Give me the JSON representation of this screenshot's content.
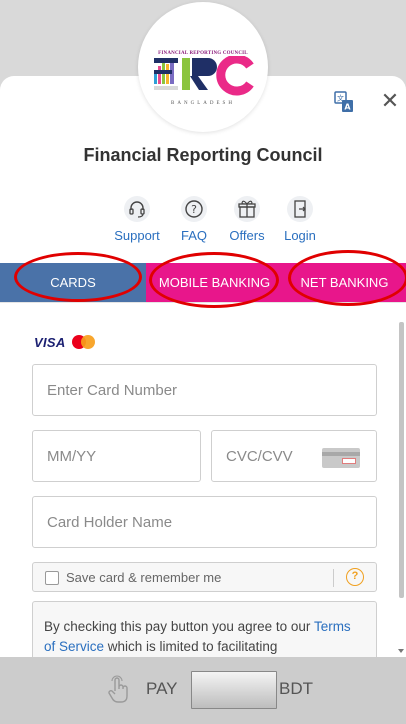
{
  "merchant": {
    "logo_text_top": "FINANCIAL REPORTING COUNCIL",
    "logo_text_main": "FRC",
    "logo_text_bottom": "BANGLADESH",
    "name": "Financial Reporting Council"
  },
  "header": {
    "close_glyph": "✕",
    "language_icon": "translate-icon"
  },
  "quick_links": [
    {
      "label": "Support",
      "icon": "headset-icon"
    },
    {
      "label": "FAQ",
      "icon": "question-icon"
    },
    {
      "label": "Offers",
      "icon": "gift-icon"
    },
    {
      "label": "Login",
      "icon": "login-icon"
    }
  ],
  "tabs": [
    {
      "label": "CARDS",
      "active": true
    },
    {
      "label": "MOBILE BANKING",
      "active": false
    },
    {
      "label": "NET BANKING",
      "active": false
    }
  ],
  "card_form": {
    "brands": [
      "VISA",
      "Mastercard"
    ],
    "card_number_placeholder": "Enter Card Number",
    "expiry_placeholder": "MM/YY",
    "cvc_placeholder": "CVC/CVV",
    "holder_placeholder": "Card Holder Name",
    "save_label": "Save card & remember me",
    "help_glyph": "?",
    "terms_prefix": "By checking this pay button you agree to our",
    "terms_link": "Terms of Service",
    "terms_suffix": "which is limited to facilitating"
  },
  "pay": {
    "label": "PAY",
    "currency": "BDT"
  },
  "colors": {
    "tab_active": "#4a72a8",
    "tab_inactive": "#e8168b",
    "link": "#2a6fbf",
    "annotation_ring": "#e00000",
    "pay_bar": "#cccccc"
  }
}
